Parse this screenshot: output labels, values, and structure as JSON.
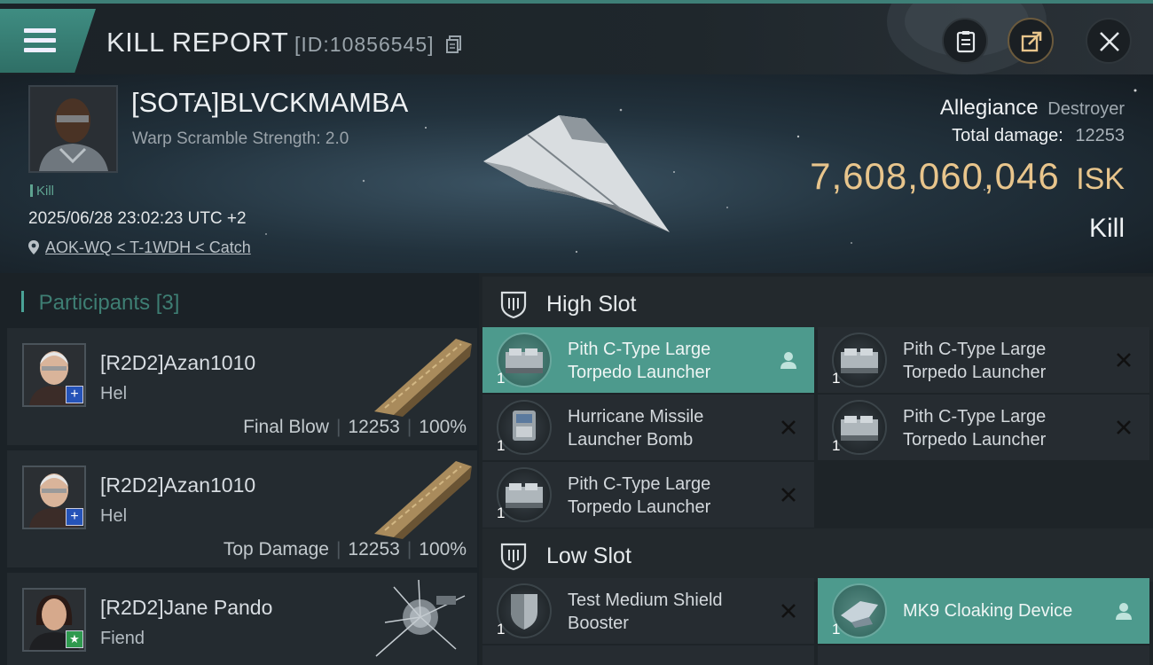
{
  "window": {
    "title": "KILL REPORT",
    "report_id": "[ID:10856545]"
  },
  "victim": {
    "name": "[SOTA]BLVCKMAMBA",
    "warp_scramble": "Warp Scramble Strength: 2.0",
    "tag": "Kill",
    "time": "2025/06/28 23:02:23 UTC +2",
    "location": "AOK-WQ < T-1WDH < Catch",
    "ship_name": "Allegiance",
    "ship_class": "Destroyer",
    "total_damage_label": "Total damage:",
    "total_damage": "12253",
    "isk_value": "7,608,060,046",
    "isk_unit": "ISK",
    "result": "Kill"
  },
  "participants": {
    "label": "Participants",
    "count": "[3]",
    "items": [
      {
        "name": "[R2D2]Azan1010",
        "ship": "Hel",
        "role": "Final Blow",
        "damage": "12253",
        "percent": "100%",
        "badge": "plus"
      },
      {
        "name": "[R2D2]Azan1010",
        "ship": "Hel",
        "role": "Top Damage",
        "damage": "12253",
        "percent": "100%",
        "badge": "plus"
      },
      {
        "name": "[R2D2]Jane Pando",
        "ship": "Fiend",
        "badge": "star"
      }
    ]
  },
  "slots": {
    "high": {
      "label": "High Slot",
      "modules": [
        {
          "line1": "Pith C-Type Large",
          "line2": "Torpedo Launcher",
          "qty": "1",
          "status": "person-icon",
          "active": true
        },
        {
          "line1": "Pith C-Type Large",
          "line2": "Torpedo Launcher",
          "qty": "1",
          "status": "cross-icon",
          "active": false
        },
        {
          "line1": "Hurricane Missile",
          "line2": "Launcher Bomb",
          "qty": "1",
          "status": "cross-icon",
          "active": false
        },
        {
          "line1": "Pith C-Type Large",
          "line2": "Torpedo Launcher",
          "qty": "1",
          "status": "cross-icon",
          "active": false
        },
        {
          "line1": "Pith C-Type Large",
          "line2": "Torpedo Launcher",
          "qty": "1",
          "status": "cross-icon",
          "active": false
        }
      ]
    },
    "low": {
      "label": "Low Slot",
      "modules": [
        {
          "line1": "Test Medium Shield",
          "line2": "Booster",
          "qty": "1",
          "status": "cross-icon",
          "active": false
        },
        {
          "line1": "MK9 Cloaking Device",
          "line2": "",
          "qty": "1",
          "status": "person-icon",
          "active": true
        }
      ]
    }
  },
  "colors": {
    "accent": "#4d9a8d",
    "isk": "#e8c58c",
    "background": "#1b2227"
  }
}
